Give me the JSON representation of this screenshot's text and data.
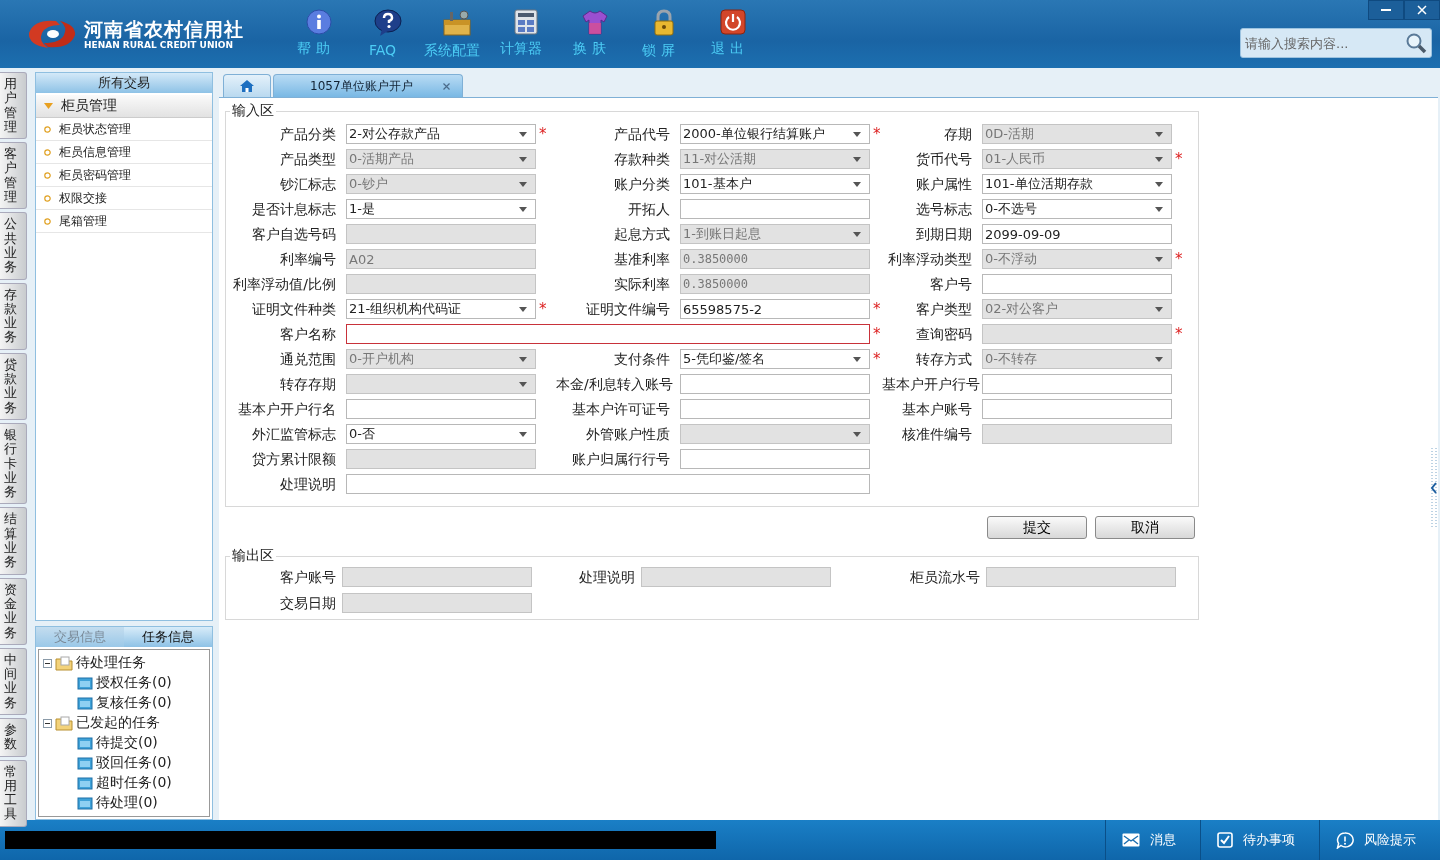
{
  "header": {
    "logo": {
      "name": "河南省农村信用社",
      "subtitle": "HENAN RURAL CREDIT UNION"
    },
    "tools": [
      {
        "kind": "help",
        "label": "帮 助"
      },
      {
        "kind": "faq",
        "label": "FAQ"
      },
      {
        "kind": "config",
        "label": "系统配置"
      },
      {
        "kind": "calculator",
        "label": "计算器"
      },
      {
        "kind": "skin",
        "label": "换 肤"
      },
      {
        "kind": "lock",
        "label": "锁 屏"
      },
      {
        "kind": "exit",
        "label": "退 出"
      }
    ],
    "search": {
      "placeholder": "请输入搜索内容..."
    }
  },
  "side_tabs": [
    "用户管理",
    "客户管理",
    "公共业务",
    "存款业务",
    "贷款业务",
    "银行卡业务",
    "结算业务",
    "资金业务",
    "中间业务",
    "参数",
    "常用工具"
  ],
  "menu": {
    "title": "所有交易",
    "group": {
      "label": "柜员管理",
      "expanded": true,
      "items": [
        "柜员状态管理",
        "柜员信息管理",
        "柜员密码管理",
        "权限交接",
        "尾箱管理"
      ]
    }
  },
  "info_panel": {
    "tabs": [
      {
        "label": "交易信息",
        "selected": false
      },
      {
        "label": "任务信息",
        "selected": true
      }
    ],
    "tree": [
      {
        "label": "待处理任务",
        "expanded": true,
        "children": [
          {
            "label": "授权任务(0)"
          },
          {
            "label": "复核任务(0)"
          }
        ]
      },
      {
        "label": "已发起的任务",
        "expanded": true,
        "children": [
          {
            "label": "待提交(0)"
          },
          {
            "label": "驳回任务(0)"
          },
          {
            "label": "超时任务(0)"
          },
          {
            "label": "待处理(0)"
          }
        ]
      }
    ]
  },
  "doc_tabs": [
    {
      "kind": "home",
      "selected": false
    },
    {
      "kind": "page",
      "label": "1057单位账户开户",
      "selected": true
    }
  ],
  "input_section": {
    "title": "输入区",
    "rows": [
      [
        {
          "label": "产品分类",
          "kind": "select",
          "value": "2-对公存款产品",
          "disabled": false,
          "invalid": false,
          "mark": "*"
        },
        {
          "label": "产品代号",
          "kind": "select",
          "value": "2000-单位银行结算账户",
          "disabled": false,
          "invalid": false,
          "mark": "*"
        },
        {
          "label": "存期",
          "kind": "select",
          "value": "0D-活期",
          "disabled": true,
          "invalid": false
        }
      ],
      [
        {
          "label": "产品类型",
          "kind": "select",
          "value": "0-活期产品",
          "disabled": true,
          "invalid": false
        },
        {
          "label": "存款种类",
          "kind": "select",
          "value": "11-对公活期",
          "disabled": true,
          "invalid": false
        },
        {
          "label": "货币代号",
          "kind": "select",
          "value": "01-人民币",
          "disabled": true,
          "invalid": false,
          "mark": "*"
        }
      ],
      [
        {
          "label": "钞汇标志",
          "kind": "select",
          "value": "0-钞户",
          "disabled": true,
          "invalid": false
        },
        {
          "label": "账户分类",
          "kind": "select",
          "value": "101-基本户",
          "disabled": false,
          "invalid": false
        },
        {
          "label": "账户属性",
          "kind": "select",
          "value": "101-单位活期存款",
          "disabled": false,
          "invalid": false
        }
      ],
      [
        {
          "label": "是否计息标志",
          "kind": "select",
          "value": "1-是",
          "disabled": false,
          "invalid": false
        },
        {
          "label": "开拓人",
          "kind": "text",
          "disabled": false,
          "invalid": false
        },
        {
          "label": "选号标志",
          "kind": "select",
          "value": "0-不选号",
          "disabled": false,
          "invalid": false
        }
      ],
      [
        {
          "label": "客户自选号码",
          "kind": "text",
          "disabled": true,
          "invalid": false
        },
        {
          "label": "起息方式",
          "kind": "select",
          "value": "1-到账日起息",
          "disabled": true,
          "invalid": false
        },
        {
          "label": "到期日期",
          "kind": "text",
          "value": "2099-09-09",
          "disabled": false,
          "invalid": false
        }
      ],
      [
        {
          "label": "利率编号",
          "kind": "text",
          "value": "A02",
          "disabled": true,
          "invalid": false
        },
        {
          "label": "基准利率",
          "kind": "text",
          "value": "0.3850000",
          "disabled": true,
          "invalid": false
        },
        {
          "label": "利率浮动类型",
          "kind": "select",
          "value": "0-不浮动",
          "disabled": true,
          "invalid": false,
          "mark": "*"
        }
      ],
      [
        {
          "label": "利率浮动值/比例",
          "kind": "text",
          "disabled": true,
          "invalid": false
        },
        {
          "label": "实际利率",
          "kind": "text",
          "value": "0.3850000",
          "disabled": true,
          "invalid": false
        },
        {
          "label": "客户号",
          "kind": "text",
          "disabled": false,
          "invalid": false
        }
      ],
      [
        {
          "label": "证明文件种类",
          "kind": "select",
          "value": "21-组织机构代码证",
          "disabled": false,
          "invalid": false,
          "mark": "*"
        },
        {
          "label": "证明文件编号",
          "kind": "text",
          "value": "65598575-2",
          "disabled": false,
          "invalid": false,
          "mark": "*"
        },
        {
          "label": "客户类型",
          "kind": "select",
          "value": "02-对公客户",
          "disabled": true,
          "invalid": false
        }
      ],
      [
        {
          "label": "客户名称",
          "kind": "wide",
          "disabled": false,
          "invalid": true,
          "mark": "*"
        },
        "",
        {
          "label": "查询密码",
          "kind": "text",
          "disabled": true,
          "invalid": false,
          "mark": "*"
        }
      ],
      [
        {
          "label": "通兑范围",
          "kind": "select",
          "value": "0-开户机构",
          "disabled": true,
          "invalid": false
        },
        {
          "label": "支付条件",
          "kind": "select",
          "value": "5-凭印鉴/签名",
          "disabled": false,
          "invalid": false,
          "mark": "*"
        },
        {
          "label": "转存方式",
          "kind": "select",
          "value": "0-不转存",
          "disabled": true,
          "invalid": false
        }
      ],
      [
        {
          "label": "转存存期",
          "kind": "select",
          "disabled": true,
          "invalid": false
        },
        {
          "label": "本金/利息转入账号",
          "kind": "text",
          "disabled": false,
          "invalid": false
        },
        {
          "label": "基本户开户行号",
          "kind": "text",
          "disabled": false,
          "invalid": false
        }
      ],
      [
        {
          "label": "基本户开户行名",
          "kind": "text",
          "disabled": false,
          "invalid": false
        },
        {
          "label": "基本户许可证号",
          "kind": "text",
          "disabled": false,
          "invalid": false
        },
        {
          "label": "基本户账号",
          "kind": "text",
          "disabled": false,
          "invalid": false
        }
      ],
      [
        {
          "label": "外汇监管标志",
          "kind": "select",
          "value": "0-否",
          "disabled": false,
          "invalid": false
        },
        {
          "label": "外管账户性质",
          "kind": "select",
          "disabled": true,
          "invalid": false
        },
        {
          "label": "核准件编号",
          "kind": "text",
          "disabled": true,
          "invalid": false
        }
      ],
      [
        {
          "label": "贷方累计限额",
          "kind": "text",
          "disabled": true,
          "invalid": false
        },
        {
          "label": "账户归属行行号",
          "kind": "text",
          "disabled": false,
          "invalid": false
        }
      ],
      [
        {
          "label": "处理说明",
          "kind": "wide",
          "disabled": false,
          "invalid": false
        }
      ]
    ]
  },
  "buttons": [
    "提交",
    "取消"
  ],
  "output_section": {
    "title": "输出区",
    "fields": [
      {
        "label": "客户账号"
      },
      {
        "label": "处理说明"
      },
      {
        "label": "柜员流水号"
      },
      {
        "label": "交易日期"
      }
    ]
  },
  "status_bar": {
    "items": [
      {
        "kind": "message",
        "label": "消息"
      },
      {
        "kind": "todo",
        "label": "待办事项"
      },
      {
        "kind": "risk",
        "label": "风险提示"
      }
    ]
  }
}
